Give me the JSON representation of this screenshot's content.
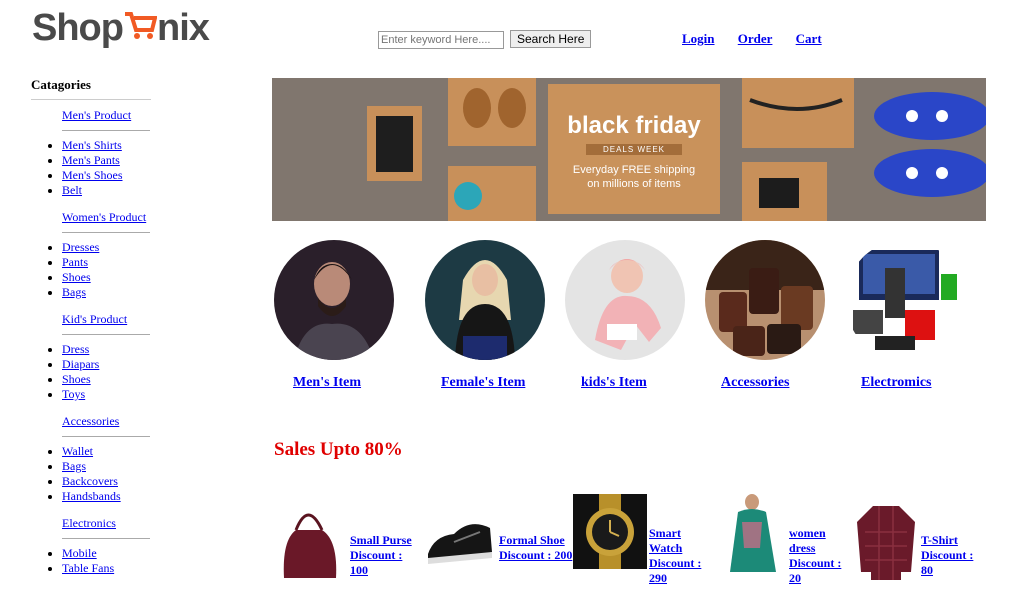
{
  "header": {
    "logo_text_left": "Shop",
    "logo_text_right": "nix",
    "search_placeholder": "Enter keyword Here....",
    "search_button": "Search Here",
    "nav": [
      "Login",
      "Order",
      "Cart"
    ]
  },
  "sidebar": {
    "title": "Catagories",
    "groups": [
      {
        "heading": "Men's Product",
        "items": [
          "Men's Shirts",
          "Men's Pants",
          "Men's Shoes",
          "Belt"
        ]
      },
      {
        "heading": "Women's Product",
        "items": [
          "Dresses",
          "Pants",
          "Shoes",
          "Bags"
        ]
      },
      {
        "heading": "Kid's Product",
        "items": [
          "Dress",
          "Diapars",
          "Shoes",
          "Toys"
        ]
      },
      {
        "heading": "Accessories",
        "items": [
          "Wallet",
          "Bags",
          "Backcovers",
          "Handsbands"
        ]
      },
      {
        "heading": "Electronics",
        "items": [
          "Mobile",
          "Table Fans"
        ]
      }
    ]
  },
  "banner": {
    "headline": "black friday",
    "badge": "DEALS WEEK",
    "line1": "Everyday FREE shipping",
    "line2": "on millions of items"
  },
  "categories": [
    {
      "label": "Men's Item"
    },
    {
      "label": "Female's Item"
    },
    {
      "label": "kids's Item"
    },
    {
      "label": "Accessories"
    },
    {
      "label": "Electromics"
    }
  ],
  "sales_title": "Sales Upto 80%",
  "products": [
    {
      "name": "Small Purse",
      "discount": "Discount : 100"
    },
    {
      "name": "Formal Shoe",
      "discount": "Discount : 200"
    },
    {
      "name": "Smart Watch",
      "discount": "Discount : 290"
    },
    {
      "name": "women dress",
      "discount": "Discount : 20"
    },
    {
      "name": "T-Shirt",
      "discount": "Discount : 80"
    }
  ],
  "colors": {
    "sale_red": "#e00000",
    "link_blue": "#0000ee",
    "logo_orange": "#f15a24",
    "logo_gray": "#4a4a4a"
  }
}
